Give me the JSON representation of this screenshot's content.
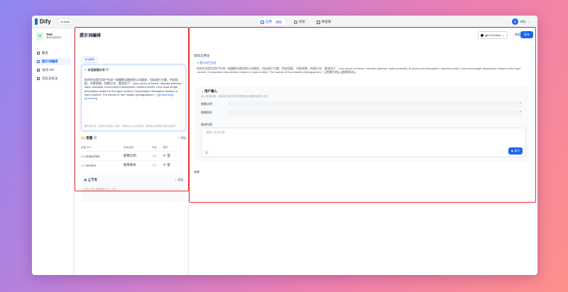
{
  "topbar": {
    "logo": "Dify",
    "workspace_chip": "UI tests",
    "nav": [
      {
        "label": "应用",
        "badge": "测试"
      },
      {
        "label": "探索"
      },
      {
        "label": "数据集"
      }
    ],
    "user": {
      "initial": "D",
      "name": "Dify"
    }
  },
  "sidebar": {
    "app_name": "Test",
    "app_sub": "简单全部测试",
    "items": [
      {
        "label": "概览"
      },
      {
        "label": "提示词编排"
      },
      {
        "label": "访问 API"
      },
      {
        "label": "日志与标注"
      }
    ]
  },
  "left": {
    "title": "提示词编排",
    "generate_btn": "自动编排",
    "prompt": {
      "head": "对话前提示词",
      "text": "你的任务是为用户生成一段摄影风格的提示词描述，包括照片主题，色彩搭配，光影效果，构图方式，要求如下：color photo of theme, intricate patterns, stark contrasts, Environment description, camera model, Lens focal length description related to the input content, Composition description relative to input content, The names of four master photographers +",
      "vars": "{{proportion}} {{version}}",
      "foot": "编写提示词，在提示词中插入变量，并使用 {{ }} 包裹变量，变量会以表单形式展示给用户"
    },
    "variables": {
      "title": "变量",
      "add": "添加",
      "columns": [
        "变量 KEY",
        "字段名称",
        "可选",
        "操作"
      ],
      "rows": [
        {
          "key": "proportion",
          "name": "图像比例"
        },
        {
          "key": "version",
          "name": "图像版本"
        }
      ]
    },
    "context": {
      "title": "上下文",
      "add": "添加",
      "desc": "您可以导入数据集作为上下文"
    }
  },
  "right": {
    "model": "gpt-3.5-turbo",
    "restore": "恢复",
    "publish": "发布",
    "debug_title": "调试与预览",
    "generated_label": "提示词已生成",
    "generated_text": "你的任务是为用户生成一段摄影风格的提示词描述，包括照片主题，色彩搭配，光影效果，构图方式，要求如下：color photo of theme, intricate patterns, stark contrasts, Environment description, camera model, Lens focal length description related to the input content, Composition description relative to input content, The names of four master photographers + {{图像比例}} {{图像版本}}",
    "input_card": {
      "title": "用户输入",
      "desc": "填入变量的值，该值将在每次提交问题时自动替换到提示词中",
      "fields": [
        {
          "label": "图像比例"
        },
        {
          "label": "图像版本"
        }
      ],
      "query_label": "查询内容",
      "query_placeholder": "请输入文本内容",
      "run": "运行"
    },
    "result_label": "结果"
  }
}
